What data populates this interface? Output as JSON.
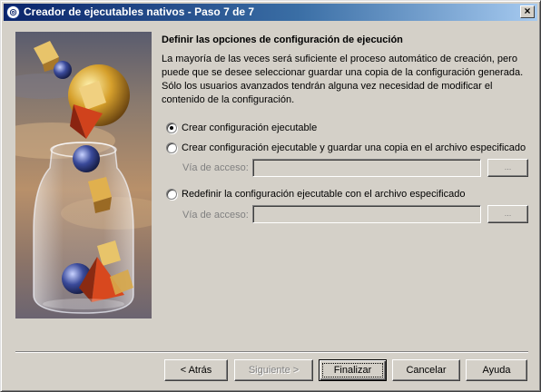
{
  "window": {
    "title": "Creador de ejecutables nativos - Paso 7 de 7",
    "close_label": "×"
  },
  "content": {
    "heading": "Definir las opciones de configuración de ejecución",
    "description": "La mayoría de las veces será suficiente el proceso automático de creación, pero puede que se desee seleccionar guardar una copia de la configuración generada. Sólo los usuarios avanzados tendrán alguna vez necesidad de modificar el contenido de la configuración.",
    "options": [
      {
        "label": "Crear configuración ejecutable",
        "checked": true
      },
      {
        "label": "Crear configuración ejecutable y guardar una copia en el archivo especificado",
        "checked": false
      },
      {
        "label": "Redefinir la configuración ejecutable con el archivo especificado",
        "checked": false
      }
    ],
    "path_label": "Vía de acceso:",
    "path1_value": "",
    "path2_value": "",
    "browse_label": "..."
  },
  "buttons": {
    "back": "< Atrás",
    "next": "Siguiente >",
    "finish": "Finalizar",
    "cancel": "Cancelar",
    "help": "Ayuda"
  }
}
